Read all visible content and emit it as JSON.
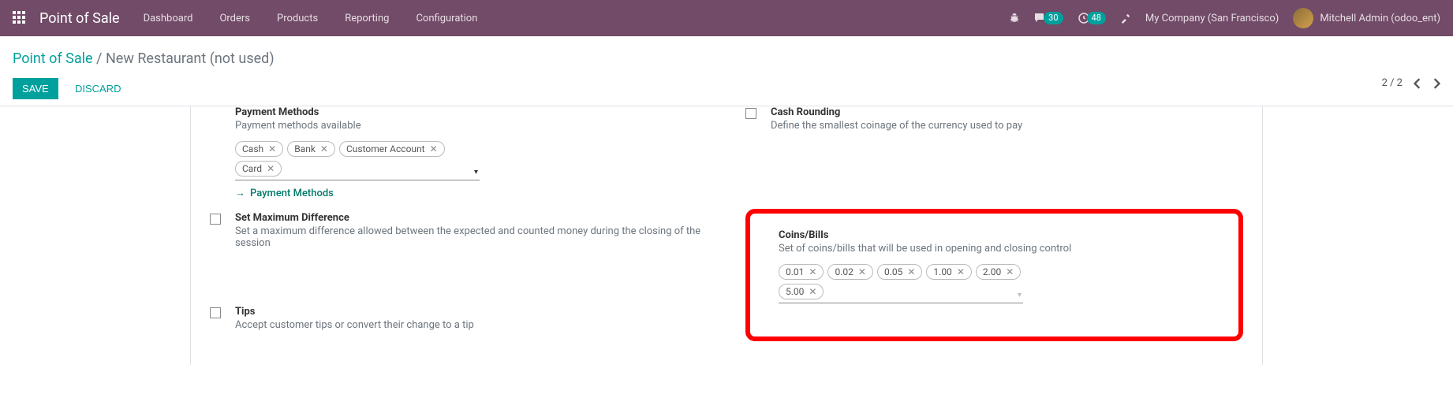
{
  "nav": {
    "brand": "Point of Sale",
    "menu": [
      "Dashboard",
      "Orders",
      "Products",
      "Reporting",
      "Configuration"
    ],
    "messages_count": "30",
    "activities_count": "48",
    "company": "My Company (San Francisco)",
    "user": "Mitchell Admin (odoo_ent)"
  },
  "breadcrumb": {
    "root": "Point of Sale",
    "current": "New Restaurant (not used)"
  },
  "buttons": {
    "save": "SAVE",
    "discard": "DISCARD"
  },
  "pager": {
    "label": "2 / 2"
  },
  "settings": {
    "payment_methods": {
      "title": "Payment Methods",
      "desc": "Payment methods available",
      "tags": [
        "Cash",
        "Bank",
        "Customer Account",
        "Card"
      ],
      "link": "Payment Methods"
    },
    "max_diff": {
      "title": "Set Maximum Difference",
      "desc": "Set a maximum difference allowed between the expected and counted money during the closing of the session"
    },
    "tips": {
      "title": "Tips",
      "desc": "Accept customer tips or convert their change to a tip"
    },
    "cash_rounding": {
      "title": "Cash Rounding",
      "desc": "Define the smallest coinage of the currency used to pay"
    },
    "coins_bills": {
      "title": "Coins/Bills",
      "desc": "Set of coins/bills that will be used in opening and closing control",
      "tags": [
        "0.01",
        "0.02",
        "0.05",
        "1.00",
        "2.00",
        "5.00"
      ]
    }
  }
}
